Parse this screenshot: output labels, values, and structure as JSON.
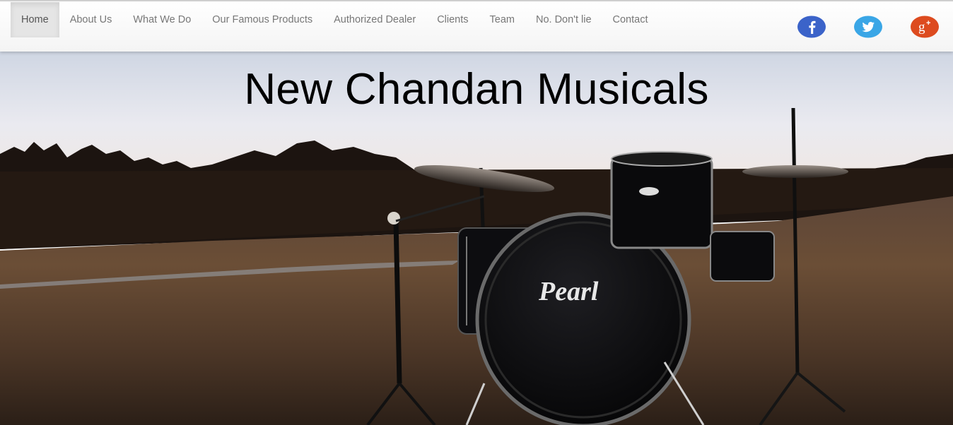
{
  "nav": {
    "items": [
      {
        "label": "Home",
        "active": true
      },
      {
        "label": "About Us"
      },
      {
        "label": "What We Do"
      },
      {
        "label": "Our Famous Products"
      },
      {
        "label": "Authorized Dealer"
      },
      {
        "label": "Clients"
      },
      {
        "label": "Team"
      },
      {
        "label": "No. Don't lie"
      },
      {
        "label": "Contact"
      }
    ]
  },
  "social": [
    {
      "icon": "facebook-icon",
      "color": "#3b63c9"
    },
    {
      "icon": "twitter-icon",
      "color": "#3aa6e6"
    },
    {
      "icon": "google-plus-icon",
      "color": "#dd4b1f"
    }
  ],
  "hero": {
    "title": "New Chandan Musicals",
    "drum_brand": "Pearl"
  }
}
